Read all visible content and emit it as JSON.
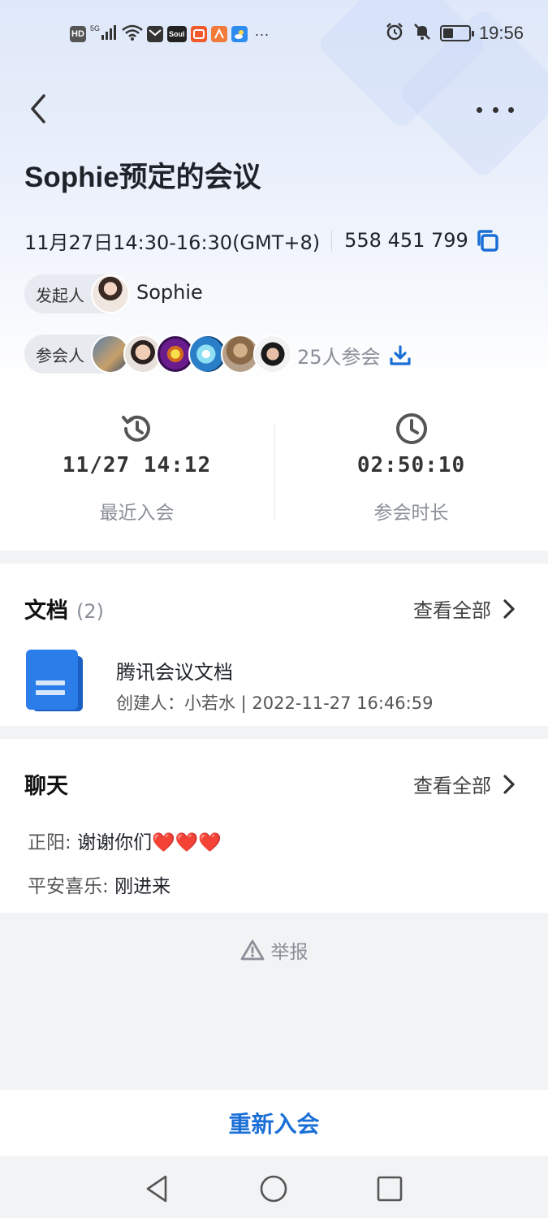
{
  "status_bar": {
    "time": "19:56",
    "left_icons": [
      "hd-icon",
      "5g-signal-icon",
      "wifi-icon",
      "mail-app-icon",
      "soul-app-icon",
      "shop-app-icon",
      "orange-app-icon",
      "weather-app-icon",
      "more-notifications-icon"
    ],
    "hd_label": "HD",
    "soul_label": "Soul",
    "more_label": "···",
    "right_icons": [
      "alarm-icon",
      "mute-icon",
      "battery-icon"
    ]
  },
  "header": {
    "title": "Sophie预定的会议",
    "time_range": "11月27日14:30-16:30(GMT+8)",
    "meeting_id": "558 451 799"
  },
  "host": {
    "label": "发起人",
    "name": "Sophie"
  },
  "attendees": {
    "label": "参会人",
    "count_text": "25人参会"
  },
  "stats": {
    "last_join_value": "11/27 14:12",
    "last_join_label": "最近入会",
    "duration_value": "02:50:10",
    "duration_label": "参会时长"
  },
  "docs": {
    "title": "文档",
    "count": "(2)",
    "view_all": "查看全部",
    "item_name": "腾讯会议文档",
    "item_meta": "创建人：小若水 | 2022-11-27 16:46:59"
  },
  "chat": {
    "title": "聊天",
    "view_all": "查看全部",
    "messages": [
      {
        "sender": "正阳: ",
        "text": "谢谢你们",
        "hearts": "❤️❤️❤️"
      },
      {
        "sender": "平安喜乐: ",
        "text": "刚进来",
        "hearts": ""
      }
    ]
  },
  "report": {
    "label": "举报"
  },
  "rejoin": {
    "label": "重新入会"
  },
  "colors": {
    "accent": "#1a6fd6",
    "doc_blue": "#2b7de9",
    "heart_red": "#e0242d"
  }
}
